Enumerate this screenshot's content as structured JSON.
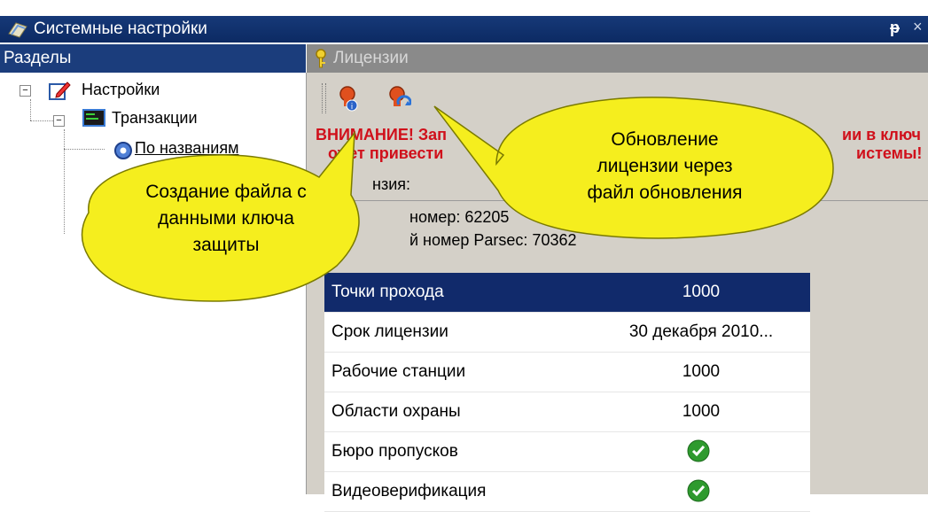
{
  "window": {
    "title": "Системные настройки",
    "pin_glyph": "ᵽ",
    "close_glyph": "×"
  },
  "left_panel": {
    "header": "Разделы",
    "tree": [
      {
        "label": "Настройки"
      },
      {
        "label": "Транзакции"
      },
      {
        "label": "По названиям"
      }
    ]
  },
  "right_panel": {
    "header": "Лицензии",
    "toolbar": [
      {
        "icon": "create-key-file-icon"
      },
      {
        "icon": "update-license-icon"
      }
    ],
    "warning_line1_left": "ВНИМАНИЕ! Зап",
    "warning_line1_right": "ии в ключ",
    "warning_line2_left": "ожет привести",
    "warning_line2_right": "истемы!",
    "info_line1": "нзия:",
    "info_line2": "номер: 62205",
    "info_line3": "й номер Parsec: 70362"
  },
  "license_table": {
    "rows": [
      {
        "name": "Точки прохода",
        "value": "1000",
        "selected": true
      },
      {
        "name": "Срок лицензии",
        "value": "30 декабря 2010...",
        "selected": false
      },
      {
        "name": "Рабочие станции",
        "value": "1000",
        "selected": false
      },
      {
        "name": "Области охраны",
        "value": "1000",
        "selected": false
      },
      {
        "name": "Бюро пропусков",
        "value": "check",
        "selected": false
      },
      {
        "name": "Видеоверификация",
        "value": "check",
        "selected": false
      }
    ]
  },
  "callouts": {
    "create_key_file": "Создание файла с данными ключа защиты",
    "create_key_file_lines": [
      "Создание файла с",
      "данными ключа",
      "защиты"
    ],
    "update_license_lines": [
      "Обновление",
      "лицензии через",
      "файл обновления"
    ]
  },
  "colors": {
    "title_bar": "#112a6b",
    "selected_row": "#112a6b",
    "warning_text": "#d0101b",
    "callout_fill": "#f5ee1e",
    "check_green": "#2e9a2e"
  }
}
